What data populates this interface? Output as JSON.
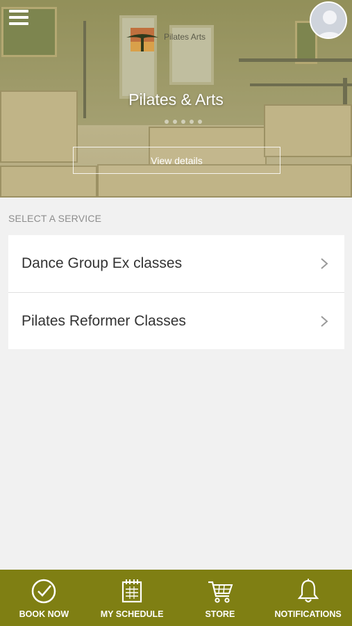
{
  "header": {
    "studio_name": "Pilates & Arts",
    "logo_text": "Pilates   Arts",
    "view_details_label": "View details"
  },
  "services": {
    "section_label": "SELECT A SERVICE",
    "items": [
      {
        "label": "Dance Group Ex classes"
      },
      {
        "label": "Pilates Reformer Classes"
      }
    ]
  },
  "tabbar": {
    "items": [
      {
        "label": "BOOK NOW",
        "icon": "check-circle-icon"
      },
      {
        "label": "MY SCHEDULE",
        "icon": "calendar-icon"
      },
      {
        "label": "STORE",
        "icon": "cart-icon"
      },
      {
        "label": "NOTIFICATIONS",
        "icon": "bell-icon"
      }
    ]
  },
  "colors": {
    "tabbar_bg": "#7f7f13",
    "page_bg": "#f1f1f1",
    "card_bg": "#ffffff"
  }
}
